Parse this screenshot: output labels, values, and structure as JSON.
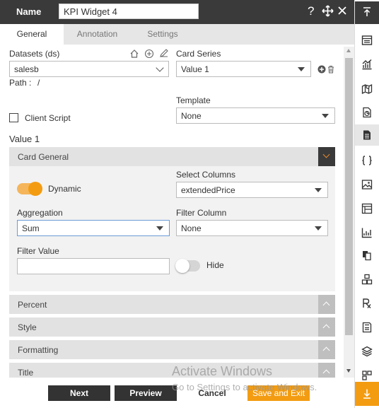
{
  "header": {
    "name_label": "Name",
    "name_value": "KPI Widget 4"
  },
  "tabs": [
    {
      "label": "General"
    },
    {
      "label": "Annotation"
    },
    {
      "label": "Settings"
    }
  ],
  "general": {
    "datasets_label": "Datasets (ds)",
    "dataset_value": "salesb",
    "path_label": "Path :",
    "path_value": "/",
    "card_series_label": "Card Series",
    "card_series_value": "Value 1",
    "template_label": "Template",
    "template_value": "None",
    "client_script_label": "Client Script",
    "value_title": "Value 1"
  },
  "card_general": {
    "title": "Card General",
    "dynamic_label": "Dynamic",
    "select_columns_label": "Select Columns",
    "select_columns_value": "extendedPrice",
    "aggregation_label": "Aggregation",
    "aggregation_value": "Sum",
    "filter_column_label": "Filter Column",
    "filter_column_value": "None",
    "filter_value_label": "Filter Value",
    "filter_value_value": "",
    "hide_label": "Hide"
  },
  "sections": [
    {
      "title": "Percent"
    },
    {
      "title": "Style"
    },
    {
      "title": "Formatting"
    },
    {
      "title": "Title"
    }
  ],
  "footer": {
    "next": "Next",
    "preview": "Preview",
    "cancel": "Cancel",
    "save_exit": "Save and Exit"
  },
  "watermark": {
    "line1": "Activate Windows",
    "line2": "Go to Settings to activate Windows."
  },
  "colors": {
    "accent": "#f39c12",
    "header_bg": "#3a3a3a",
    "button_dark": "#333333"
  }
}
